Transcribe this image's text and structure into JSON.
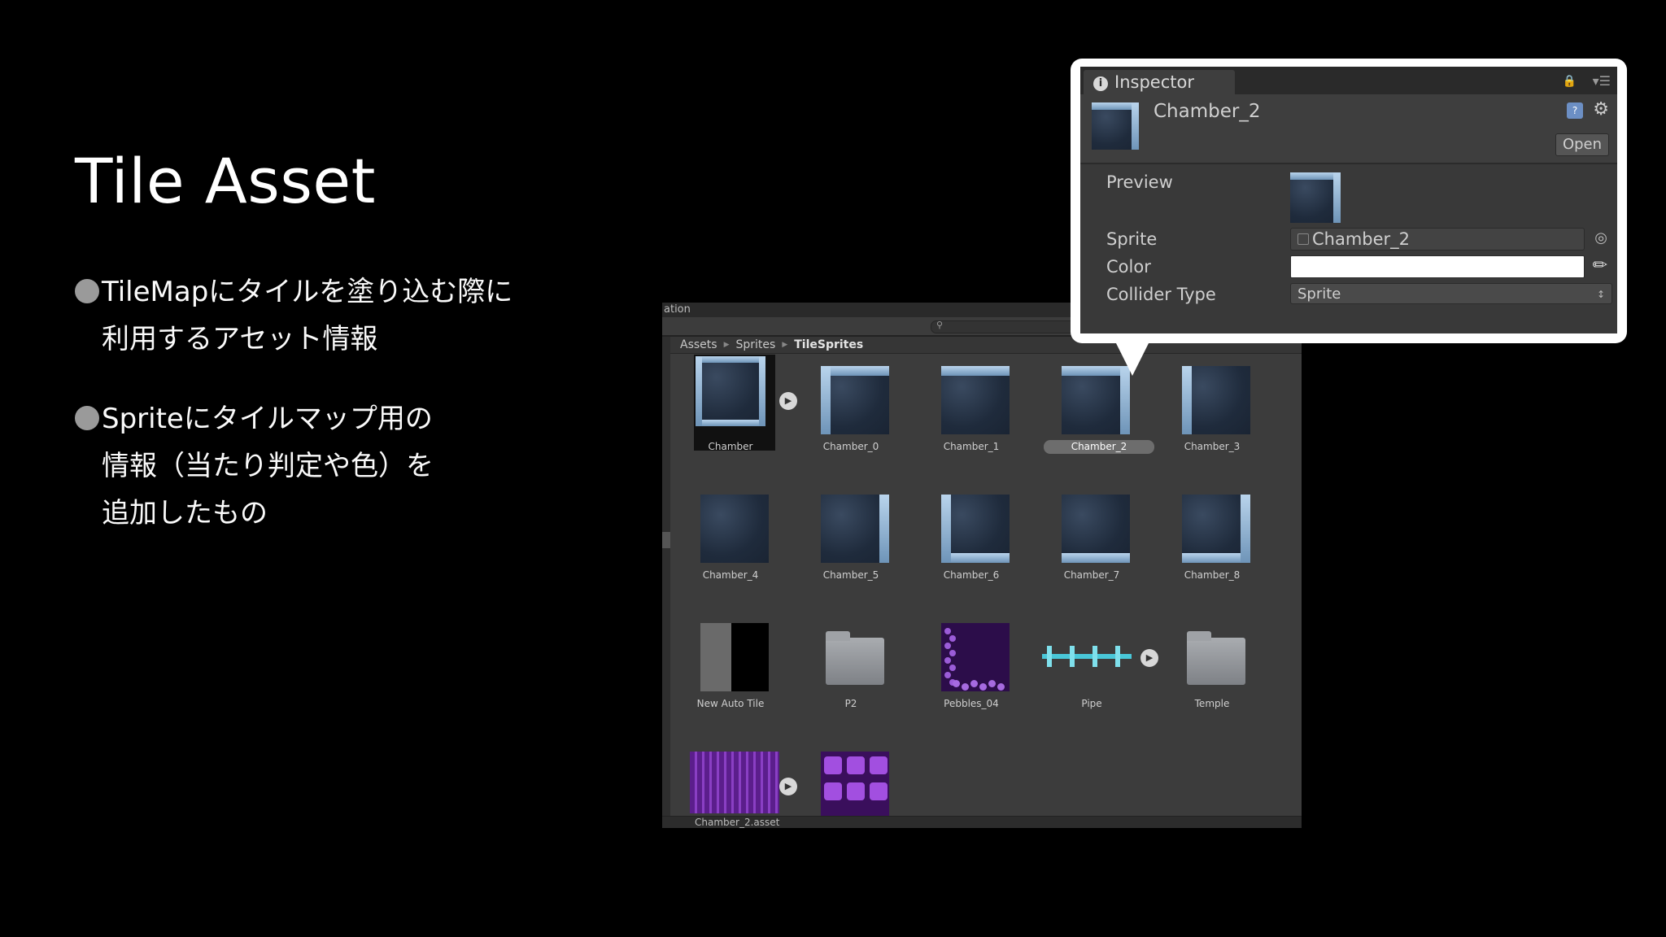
{
  "slide": {
    "title": "Tile Asset",
    "bullets": [
      {
        "lines": [
          "TileMapにタイルを塗り込む際に",
          "利用するアセット情報"
        ]
      },
      {
        "lines": [
          "Spriteにタイルマップ用の",
          "情報（当たり判定や色）を",
          "追加したもの"
        ]
      }
    ]
  },
  "project": {
    "tab_label": "ation",
    "breadcrumb": [
      "Assets",
      "Sprites",
      "TileSprites"
    ],
    "items": [
      {
        "label": "Chamber",
        "kind": "frame-full",
        "play": true
      },
      {
        "label": "Chamber_0",
        "kind": "corner-tl"
      },
      {
        "label": "Chamber_1",
        "kind": "edge-top"
      },
      {
        "label": "Chamber_2",
        "kind": "corner-tr",
        "selected": true
      },
      {
        "label": "Chamber_3",
        "kind": "edge-left"
      },
      {
        "label": "Chamber_4",
        "kind": "plain"
      },
      {
        "label": "Chamber_5",
        "kind": "edge-right"
      },
      {
        "label": "Chamber_6",
        "kind": "corner-bl"
      },
      {
        "label": "Chamber_7",
        "kind": "edge-bottom"
      },
      {
        "label": "Chamber_8",
        "kind": "corner-br"
      },
      {
        "label": "New Auto Tile",
        "kind": "auto-tile"
      },
      {
        "label": "P2",
        "kind": "folder"
      },
      {
        "label": "Pebbles_04",
        "kind": "pebbles"
      },
      {
        "label": "Pipe",
        "kind": "pipe",
        "play": true
      },
      {
        "label": "Temple",
        "kind": "folder"
      },
      {
        "label": "",
        "kind": "purple-sheet",
        "play": true
      },
      {
        "label": "",
        "kind": "purple-blocks"
      }
    ],
    "status_text": "Chamber_2.asset"
  },
  "inspector": {
    "tab_label": "Inspector",
    "asset_name": "Chamber_2",
    "open_label": "Open",
    "preview_label": "Preview",
    "sprite_label": "Sprite",
    "sprite_value": "Chamber_2",
    "color_label": "Color",
    "color_value": "#ffffff",
    "collider_label": "Collider Type",
    "collider_value": "Sprite"
  }
}
